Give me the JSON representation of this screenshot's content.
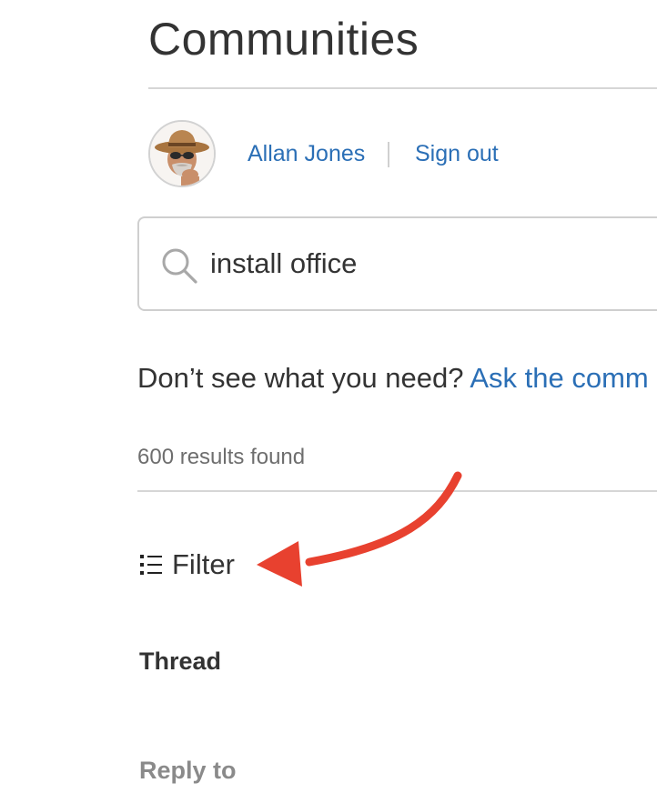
{
  "header": {
    "title": "Communities"
  },
  "user": {
    "name": "Allan Jones",
    "sign_out_label": "Sign out",
    "avatar_icon": "memoji-avatar-icon"
  },
  "search": {
    "value": "install office",
    "icon": "search-icon"
  },
  "prompt": {
    "text": "Don’t see what you need?",
    "link_label": "Ask the comm"
  },
  "results": {
    "summary": "600 results found"
  },
  "filter": {
    "label": "Filter",
    "icon": "list-icon"
  },
  "sections": {
    "thread_label": "Thread",
    "reply_label": "Reply to"
  },
  "annotation": {
    "arrow_color": "#e8412f",
    "points_to": "filter"
  },
  "colors": {
    "link": "#2b6fb6",
    "text": "#333333",
    "muted": "#6e6e6e",
    "divider": "#d6d6d6"
  }
}
